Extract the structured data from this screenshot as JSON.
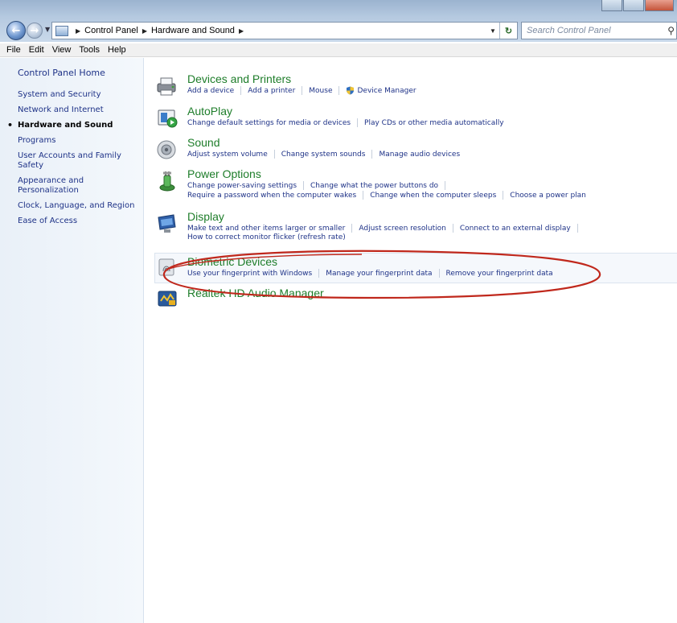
{
  "address": {
    "crumbs": [
      "Control Panel",
      "Hardware and Sound"
    ],
    "search_placeholder": "Search Control Panel"
  },
  "menu": [
    "File",
    "Edit",
    "View",
    "Tools",
    "Help"
  ],
  "sidebar": {
    "home": "Control Panel Home",
    "items": [
      {
        "label": "System and Security"
      },
      {
        "label": "Network and Internet"
      },
      {
        "label": "Hardware and Sound"
      },
      {
        "label": "Programs"
      },
      {
        "label": "User Accounts and Family Safety"
      },
      {
        "label": "Appearance and Personalization"
      },
      {
        "label": "Clock, Language, and Region"
      },
      {
        "label": "Ease of Access"
      }
    ],
    "active": "Hardware and Sound"
  },
  "categories": [
    {
      "title": "Devices and Printers",
      "icon": "printer-icon",
      "lines": [
        [
          "Add a device",
          "Add a printer",
          "Mouse",
          "Device Manager"
        ]
      ]
    },
    {
      "title": "AutoPlay",
      "icon": "autoplay-icon",
      "lines": [
        [
          "Change default settings for media or devices",
          "Play CDs or other media automatically"
        ]
      ]
    },
    {
      "title": "Sound",
      "icon": "speaker-icon",
      "lines": [
        [
          "Adjust system volume",
          "Change system sounds",
          "Manage audio devices"
        ]
      ]
    },
    {
      "title": "Power Options",
      "icon": "power-icon",
      "lines": [
        [
          "Change power-saving settings",
          "Change what the power buttons do"
        ],
        [
          "Require a password when the computer wakes",
          "Change when the computer sleeps",
          "Choose a power plan"
        ]
      ]
    },
    {
      "title": "Display",
      "icon": "display-icon",
      "lines": [
        [
          "Make text and other items larger or smaller",
          "Adjust screen resolution",
          "Connect to an external display"
        ],
        [
          "How to correct monitor flicker (refresh rate)"
        ]
      ]
    },
    {
      "title": "Biometric Devices",
      "icon": "fingerprint-icon",
      "lines": [
        [
          "Use your fingerprint with Windows",
          "Manage your fingerprint data",
          "Remove your fingerprint data"
        ]
      ]
    },
    {
      "title": "Realtek HD Audio Manager",
      "icon": "audio-manager-icon",
      "lines": []
    }
  ],
  "colors": {
    "category_title": "#1e7d2a",
    "link": "#1e3287",
    "annotation": "#c0281c"
  }
}
